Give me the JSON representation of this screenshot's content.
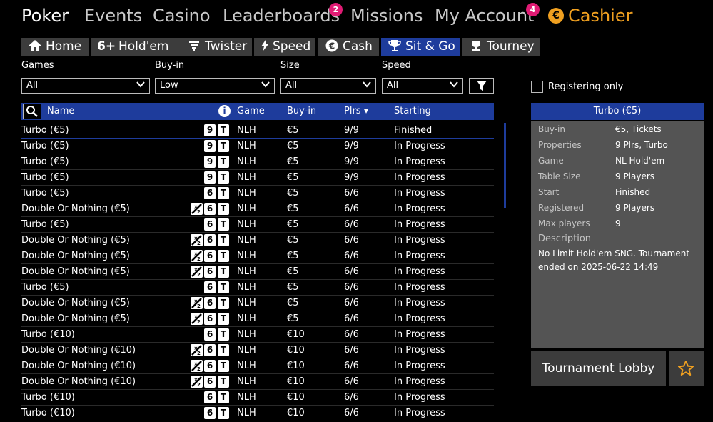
{
  "topnav": {
    "items": [
      "Poker",
      "Events",
      "Casino",
      "Leaderboards",
      "Missions",
      "My Account",
      "Cashier"
    ],
    "badges": {
      "leaderboards": "2",
      "my_account": "4"
    },
    "accent": "#f0a020"
  },
  "tabs": [
    {
      "label": "Home",
      "icon": "home-icon"
    },
    {
      "label": "Hold'em",
      "icon": "six-plus-icon",
      "icon_text": "6+"
    },
    {
      "label": "Twister",
      "icon": "twister-icon"
    },
    {
      "label": "Speed",
      "icon": "lightning-icon"
    },
    {
      "label": "Cash",
      "icon": "euro-icon"
    },
    {
      "label": "Sit & Go",
      "icon": "trophy-icon",
      "active": true
    },
    {
      "label": "Tourney",
      "icon": "tourney-icon"
    }
  ],
  "filters": [
    {
      "label": "Games",
      "value": "All"
    },
    {
      "label": "Buy-in",
      "value": "Low"
    },
    {
      "label": "Size",
      "value": "All"
    },
    {
      "label": "Speed",
      "value": "All"
    }
  ],
  "registering_only": "Registering only",
  "table": {
    "columns": [
      "Name",
      "Game",
      "Buy-in",
      "Plrs ▾",
      "Starting"
    ],
    "info_icon": "i",
    "rows": [
      {
        "name": "Turbo (€5)",
        "don": false,
        "size": "9",
        "speed": "T",
        "game": "NLH",
        "buyin": "€5",
        "plrs": "9/9",
        "starting": "Finished"
      },
      {
        "name": "Turbo (€5)",
        "don": false,
        "size": "9",
        "speed": "T",
        "game": "NLH",
        "buyin": "€5",
        "plrs": "9/9",
        "starting": "In Progress"
      },
      {
        "name": "Turbo (€5)",
        "don": false,
        "size": "9",
        "speed": "T",
        "game": "NLH",
        "buyin": "€5",
        "plrs": "9/9",
        "starting": "In Progress"
      },
      {
        "name": "Turbo (€5)",
        "don": false,
        "size": "9",
        "speed": "T",
        "game": "NLH",
        "buyin": "€5",
        "plrs": "9/9",
        "starting": "In Progress"
      },
      {
        "name": "Turbo (€5)",
        "don": false,
        "size": "6",
        "speed": "T",
        "game": "NLH",
        "buyin": "€5",
        "plrs": "6/6",
        "starting": "In Progress"
      },
      {
        "name": "Double Or Nothing (€5)",
        "don": true,
        "size": "6",
        "speed": "T",
        "game": "NLH",
        "buyin": "€5",
        "plrs": "6/6",
        "starting": "In Progress"
      },
      {
        "name": "Turbo (€5)",
        "don": false,
        "size": "6",
        "speed": "T",
        "game": "NLH",
        "buyin": "€5",
        "plrs": "6/6",
        "starting": "In Progress"
      },
      {
        "name": "Double Or Nothing (€5)",
        "don": true,
        "size": "6",
        "speed": "T",
        "game": "NLH",
        "buyin": "€5",
        "plrs": "6/6",
        "starting": "In Progress"
      },
      {
        "name": "Double Or Nothing (€5)",
        "don": true,
        "size": "6",
        "speed": "T",
        "game": "NLH",
        "buyin": "€5",
        "plrs": "6/6",
        "starting": "In Progress"
      },
      {
        "name": "Double Or Nothing (€5)",
        "don": true,
        "size": "6",
        "speed": "T",
        "game": "NLH",
        "buyin": "€5",
        "plrs": "6/6",
        "starting": "In Progress"
      },
      {
        "name": "Turbo (€5)",
        "don": false,
        "size": "6",
        "speed": "T",
        "game": "NLH",
        "buyin": "€5",
        "plrs": "6/6",
        "starting": "In Progress"
      },
      {
        "name": "Double Or Nothing (€5)",
        "don": true,
        "size": "6",
        "speed": "T",
        "game": "NLH",
        "buyin": "€5",
        "plrs": "6/6",
        "starting": "In Progress"
      },
      {
        "name": "Double Or Nothing (€5)",
        "don": true,
        "size": "6",
        "speed": "T",
        "game": "NLH",
        "buyin": "€5",
        "plrs": "6/6",
        "starting": "In Progress"
      },
      {
        "name": "Turbo (€10)",
        "don": false,
        "size": "6",
        "speed": "T",
        "game": "NLH",
        "buyin": "€10",
        "plrs": "6/6",
        "starting": "In Progress"
      },
      {
        "name": "Double Or Nothing (€10)",
        "don": true,
        "size": "6",
        "speed": "T",
        "game": "NLH",
        "buyin": "€10",
        "plrs": "6/6",
        "starting": "In Progress"
      },
      {
        "name": "Double Or Nothing (€10)",
        "don": true,
        "size": "6",
        "speed": "T",
        "game": "NLH",
        "buyin": "€10",
        "plrs": "6/6",
        "starting": "In Progress"
      },
      {
        "name": "Double Or Nothing (€10)",
        "don": true,
        "size": "6",
        "speed": "T",
        "game": "NLH",
        "buyin": "€10",
        "plrs": "6/6",
        "starting": "In Progress"
      },
      {
        "name": "Turbo (€10)",
        "don": false,
        "size": "6",
        "speed": "T",
        "game": "NLH",
        "buyin": "€10",
        "plrs": "6/6",
        "starting": "In Progress"
      },
      {
        "name": "Turbo (€10)",
        "don": false,
        "size": "6",
        "speed": "T",
        "game": "NLH",
        "buyin": "€10",
        "plrs": "6/6",
        "starting": "In Progress"
      }
    ]
  },
  "detail": {
    "title": "Turbo (€5)",
    "fields": [
      {
        "key": "Buy-in",
        "value": "€5, Tickets"
      },
      {
        "key": "Properties",
        "value": "9 Plrs, Turbo"
      },
      {
        "key": "Game",
        "value": "NL Hold'em"
      },
      {
        "key": "Table Size",
        "value": "9 Players"
      },
      {
        "key": "Start",
        "value": "Finished"
      },
      {
        "key": "Registered",
        "value": "9 Players"
      },
      {
        "key": "Max players",
        "value": "9"
      }
    ],
    "description_label": "Description",
    "description": "No Limit Hold'em SNG. Tournament ended on 2025-06-22 14:49",
    "lobby_button": "Tournament Lobby",
    "favorite_icon": "star-icon"
  }
}
